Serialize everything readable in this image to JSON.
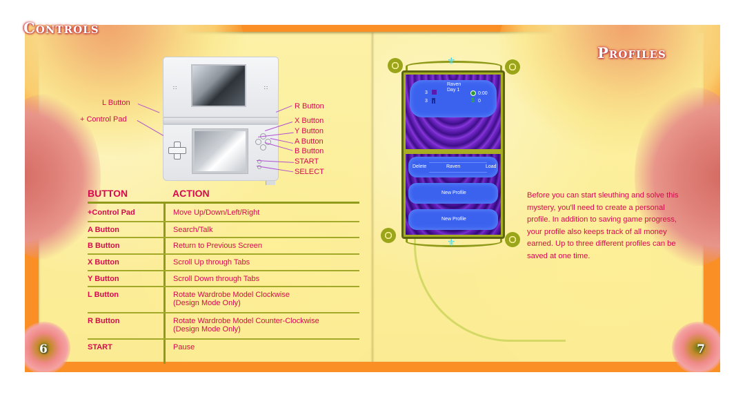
{
  "left_page": {
    "title": "Controls",
    "page_number": "6",
    "device_callouts": {
      "l_button": "L Button",
      "control_pad": "+ Control Pad",
      "r_button": "R Button",
      "x_button": "X Button",
      "y_button": "Y Button",
      "a_button": "A Button",
      "b_button": "B Button",
      "start": "START",
      "select": "SELECT"
    },
    "table": {
      "headers": {
        "button": "BUTTON",
        "action": "ACTION"
      },
      "rows": [
        {
          "button": "+Control Pad",
          "action": "Move Up/Down/Left/Right"
        },
        {
          "button": "A Button",
          "action": "Search/Talk"
        },
        {
          "button": "B Button",
          "action": "Return to Previous Screen"
        },
        {
          "button": "X Button",
          "action": "Scroll Up through Tabs"
        },
        {
          "button": "Y Button",
          "action": "Scroll Down through Tabs"
        },
        {
          "button": "L Button",
          "action": "Rotate Wardrobe Model Clockwise",
          "action_note": "(Design Mode Only)"
        },
        {
          "button": "R Button",
          "action": "Rotate Wardrobe Model Counter-Clockwise",
          "action_note": "(Design Mode Only)"
        },
        {
          "button": "START",
          "action": "Pause"
        }
      ]
    }
  },
  "right_page": {
    "title": "Profiles",
    "page_number": "7",
    "game_screen": {
      "info": {
        "name": "Raven",
        "day": "Day 1",
        "tops_count": "3",
        "bottoms_count": "3",
        "time": "0:00",
        "money": "0"
      },
      "slots": [
        {
          "left_action": "Delete",
          "name": "Raven",
          "right_action": "Load"
        },
        {
          "label": "New Profile"
        },
        {
          "label": "New Profile"
        }
      ]
    },
    "description": "Before you can start sleuthing and solve this mystery, you'll need to create a personal profile.  In addition to saving game progress, your profile also keeps track of all money earned. Up to three different profiles can be saved at one time."
  },
  "colors": {
    "border_orange": "#f98f25",
    "page_yellow": "#fbef9c",
    "text_magenta": "#d6094e",
    "rule_olive": "#8f9a1a",
    "callout_line": "#b04fd0"
  }
}
